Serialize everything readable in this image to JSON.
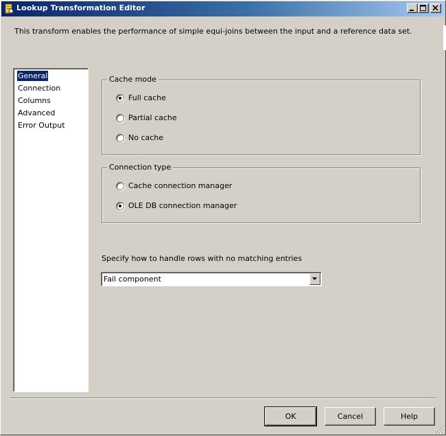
{
  "window": {
    "title": "Lookup Transformation Editor",
    "icon": "lookup-transform-icon",
    "controls": [
      "minimize-icon",
      "maximize-icon",
      "close-icon"
    ]
  },
  "description": "This transform enables the performance of simple equi-joins between the input and a reference data set.",
  "nav": {
    "items": [
      "General",
      "Connection",
      "Columns",
      "Advanced",
      "Error Output"
    ],
    "selected": "General"
  },
  "cache_mode": {
    "legend": "Cache mode",
    "options": [
      "Full cache",
      "Partial cache",
      "No cache"
    ],
    "selected": "Full cache"
  },
  "connection_type": {
    "legend": "Connection type",
    "options": [
      "Cache connection manager",
      "OLE DB connection manager"
    ],
    "selected": "OLE DB connection manager"
  },
  "no_match": {
    "label": "Specify how to handle rows with no matching entries",
    "value": "Fail component"
  },
  "buttons": {
    "ok": "OK",
    "cancel": "Cancel",
    "help": "Help"
  },
  "colors": {
    "title_start": "#0a246a",
    "title_end": "#a6caf0",
    "selection": "#0a246a",
    "face": "#d4d0c8"
  }
}
